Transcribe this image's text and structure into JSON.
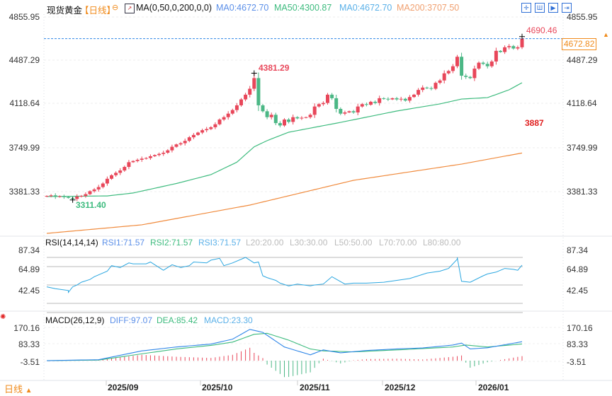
{
  "header": {
    "symbol": "现货黄金",
    "period": "【日线】",
    "indicator": "MA(0,50,0,200,0,0)",
    "ma0": "MA0:4672.70",
    "ma50": "MA50:4300.87",
    "ma0b": "MA0:4672.70",
    "ma200": "MA200:3707.50",
    "toolbar_icons": [
      "crosshair-icon",
      "bar-chart-icon",
      "step-forward-icon",
      "exit-icon"
    ]
  },
  "price_axis": {
    "labels": [
      "4855.95",
      "4487.29",
      "4118.64",
      "3749.99",
      "3381.33"
    ],
    "current_price": "4672.82",
    "max_label": "4690.46",
    "peak_label": "4381.29",
    "low_label": "3311.40",
    "side_label": "3887"
  },
  "rsi": {
    "title": "RSI(14,14,14)",
    "rsi1": "RSI1:71.57",
    "rsi2": "RSI2:71.57",
    "rsi3": "RSI3:71.57",
    "l20": "L20:20.00",
    "l30": "L30:30.00",
    "l50": "L50:50.00",
    "l70": "L70:70.00",
    "l80": "L80:80.00",
    "axis_labels": [
      "87.34",
      "64.89",
      "42.45"
    ],
    "levels": [
      80,
      70,
      50,
      30,
      20
    ],
    "series": [
      [
        0,
        48
      ],
      [
        2,
        46
      ],
      [
        5,
        44
      ],
      [
        5,
        42
      ],
      [
        6,
        48
      ],
      [
        7,
        50
      ],
      [
        8,
        53
      ],
      [
        10,
        56
      ],
      [
        11,
        59
      ],
      [
        14,
        65
      ],
      [
        15,
        71
      ],
      [
        17,
        69
      ],
      [
        19,
        74
      ],
      [
        20,
        73
      ],
      [
        23,
        73
      ],
      [
        24,
        75
      ],
      [
        26,
        69
      ],
      [
        27,
        66
      ],
      [
        29,
        72
      ],
      [
        31,
        69
      ],
      [
        33,
        71
      ],
      [
        34,
        75
      ],
      [
        37,
        74
      ],
      [
        38,
        77
      ],
      [
        40,
        79
      ],
      [
        41,
        71
      ],
      [
        43,
        74
      ],
      [
        46,
        80
      ],
      [
        48,
        74
      ],
      [
        49,
        75
      ],
      [
        50,
        60
      ],
      [
        51,
        58
      ],
      [
        53,
        55
      ],
      [
        54,
        52
      ],
      [
        56,
        49
      ],
      [
        58,
        51
      ],
      [
        61,
        49
      ],
      [
        62,
        50
      ],
      [
        64,
        51
      ],
      [
        65,
        55
      ],
      [
        66,
        59
      ],
      [
        69,
        51
      ],
      [
        71,
        52
      ],
      [
        74,
        52
      ],
      [
        78,
        53
      ],
      [
        81,
        55
      ],
      [
        84,
        57
      ],
      [
        88,
        63
      ],
      [
        91,
        65
      ],
      [
        93,
        68
      ],
      [
        95,
        78
      ],
      [
        95,
        80
      ],
      [
        96,
        54
      ],
      [
        98,
        53
      ],
      [
        101,
        60
      ],
      [
        102,
        62
      ],
      [
        104,
        64
      ],
      [
        106,
        68
      ],
      [
        108,
        67
      ],
      [
        109,
        66
      ],
      [
        110,
        71.57
      ]
    ]
  },
  "macd": {
    "title": "MACD(26,12,9)",
    "diff_label": "DIFF:97.07",
    "dea_label": "DEA:85.42",
    "macd_label": "MACD:23.30",
    "axis_labels": [
      "170.16",
      "83.33",
      "-3.51"
    ],
    "diff": [
      [
        0,
        0
      ],
      [
        12,
        5
      ],
      [
        22,
        50
      ],
      [
        30,
        70
      ],
      [
        38,
        85
      ],
      [
        43,
        110
      ],
      [
        47,
        160
      ],
      [
        50,
        145
      ],
      [
        55,
        70
      ],
      [
        61,
        30
      ],
      [
        64,
        55
      ],
      [
        68,
        40
      ],
      [
        74,
        52
      ],
      [
        81,
        60
      ],
      [
        87,
        65
      ],
      [
        94,
        80
      ],
      [
        96,
        90
      ],
      [
        98,
        60
      ],
      [
        102,
        66
      ],
      [
        110,
        97.07
      ]
    ],
    "dea": [
      [
        0,
        0
      ],
      [
        12,
        3
      ],
      [
        22,
        35
      ],
      [
        30,
        60
      ],
      [
        38,
        78
      ],
      [
        43,
        95
      ],
      [
        48,
        135
      ],
      [
        51,
        140
      ],
      [
        56,
        105
      ],
      [
        61,
        60
      ],
      [
        64,
        50
      ],
      [
        71,
        45
      ],
      [
        81,
        55
      ],
      [
        94,
        70
      ],
      [
        97,
        80
      ],
      [
        102,
        70
      ],
      [
        110,
        85.42
      ]
    ]
  },
  "candles": {
    "closes": [
      3345,
      3350,
      3338,
      3342,
      3335,
      3328,
      3320,
      3340,
      3345,
      3360,
      3385,
      3400,
      3420,
      3450,
      3490,
      3520,
      3540,
      3560,
      3590,
      3630,
      3640,
      3650,
      3660,
      3665,
      3680,
      3690,
      3700,
      3710,
      3730,
      3760,
      3780,
      3790,
      3810,
      3840,
      3860,
      3880,
      3900,
      3910,
      3925,
      3950,
      3990,
      4010,
      4040,
      4070,
      4110,
      4160,
      4200,
      4250,
      4340,
      4110,
      4060,
      4010,
      4030,
      3960,
      3940,
      3990,
      3970,
      4010,
      4000,
      4005,
      4010,
      4030,
      4100,
      4120,
      4130,
      4200,
      4170,
      4080,
      4040,
      4050,
      4060,
      4050,
      4100,
      4120,
      4115,
      4140,
      4130,
      4170,
      4165,
      4160,
      4170,
      4160,
      4165,
      4150,
      4180,
      4200,
      4240,
      4260,
      4255,
      4250,
      4300,
      4320,
      4380,
      4400,
      4440,
      4520,
      4360,
      4350,
      4340,
      4420,
      4470,
      4460,
      4440,
      4480,
      4570,
      4560,
      4600,
      4610,
      4590,
      4600,
      4672.82
    ],
    "first_open": 3340,
    "max_high": {
      "index": 48,
      "value": 4381.29
    },
    "min_low": {
      "index": 6,
      "value": 3311.4
    },
    "last_high": 4690.46
  },
  "ma50": [
    [
      0,
      3340
    ],
    [
      14,
      3345
    ],
    [
      20,
      3370
    ],
    [
      30,
      3450
    ],
    [
      38,
      3525
    ],
    [
      44,
      3630
    ],
    [
      48,
      3760
    ],
    [
      51,
      3812
    ],
    [
      56,
      3883
    ],
    [
      68,
      3966
    ],
    [
      81,
      4062
    ],
    [
      91,
      4122
    ],
    [
      96,
      4163
    ],
    [
      102,
      4175
    ],
    [
      107,
      4241
    ],
    [
      110,
      4300.87
    ]
  ],
  "ma200": [
    [
      0,
      3029
    ],
    [
      22,
      3101
    ],
    [
      47,
      3268
    ],
    [
      71,
      3477
    ],
    [
      96,
      3614
    ],
    [
      110,
      3707.5
    ]
  ],
  "time_axis": {
    "period_button": "日线",
    "labels": [
      "2025/09",
      "2025/10",
      "2025/11",
      "2025/12",
      "2026/01"
    ]
  },
  "colors": {
    "up": "#e8475a",
    "down": "#4bb785",
    "ma50": "#3dbb7e",
    "ma200": "#f08a3c",
    "rsi": "#2aa6e0",
    "diff": "#2f86e8",
    "dea": "#3dbb7e",
    "accent": "#f08a1a"
  }
}
